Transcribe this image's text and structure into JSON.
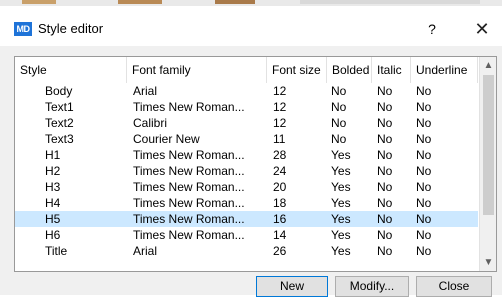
{
  "window": {
    "title": "Style editor",
    "icon_text": "MD",
    "help_label": "?",
    "close_label": "✕"
  },
  "table": {
    "columns": [
      "Style",
      "Font family",
      "Font size",
      "Bolded",
      "Italic",
      "Underline"
    ],
    "rows": [
      [
        "Body",
        "Arial",
        "12",
        "No",
        "No",
        "No"
      ],
      [
        "Text1",
        "Times New Roman...",
        "12",
        "No",
        "No",
        "No"
      ],
      [
        "Text2",
        "Calibri",
        "12",
        "No",
        "No",
        "No"
      ],
      [
        "Text3",
        "Courier New",
        "11",
        "No",
        "No",
        "No"
      ],
      [
        "H1",
        "Times New Roman...",
        "28",
        "Yes",
        "No",
        "No"
      ],
      [
        "H2",
        "Times New Roman...",
        "24",
        "Yes",
        "No",
        "No"
      ],
      [
        "H3",
        "Times New Roman...",
        "20",
        "Yes",
        "No",
        "No"
      ],
      [
        "H4",
        "Times New Roman...",
        "18",
        "Yes",
        "No",
        "No"
      ],
      [
        "H5",
        "Times New Roman...",
        "16",
        "Yes",
        "No",
        "No"
      ],
      [
        "H6",
        "Times New Roman...",
        "14",
        "Yes",
        "No",
        "No"
      ],
      [
        "Title",
        "Arial",
        "26",
        "Yes",
        "No",
        "No"
      ]
    ],
    "selected_row": "H5"
  },
  "buttons": {
    "new": "New",
    "modify": "Modify...",
    "close": "Close"
  },
  "colors": {
    "selection": "#cce8ff",
    "icon": "#1e73d8"
  }
}
